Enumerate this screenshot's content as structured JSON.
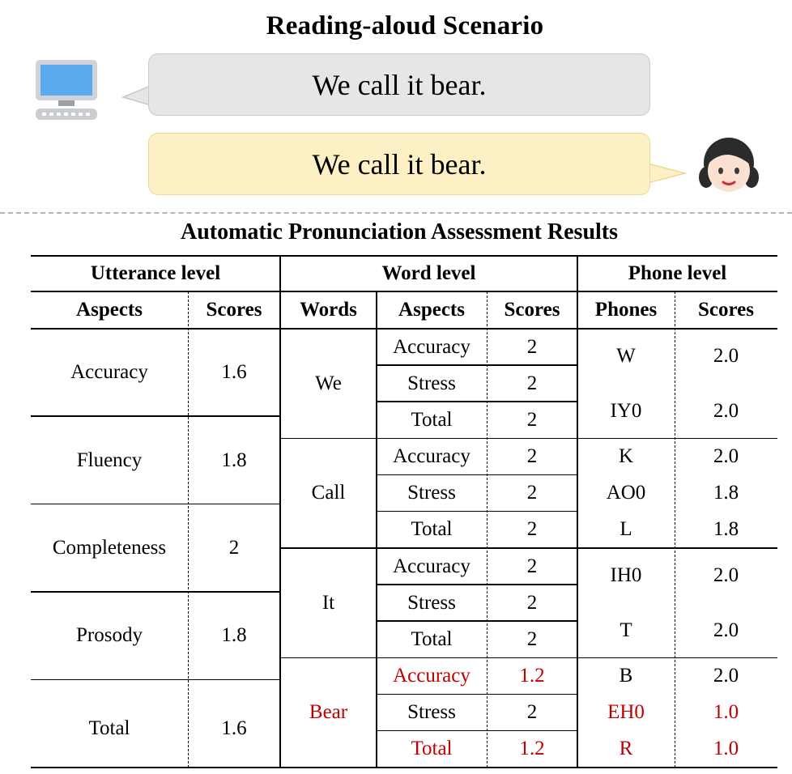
{
  "title": "Reading-aloud Scenario",
  "dialogue": {
    "system_text": "We call it bear.",
    "user_text": "We call it bear."
  },
  "icons": {
    "system": "computer-icon",
    "user": "girl-face-icon"
  },
  "table_title": "Automatic Pronunciation Assessment Results",
  "colors": {
    "error": "#c00000"
  },
  "headers": {
    "utterance_level": "Utterance level",
    "word_level": "Word level",
    "phone_level": "Phone level",
    "aspects": "Aspects",
    "scores": "Scores",
    "words": "Words",
    "phones": "Phones"
  },
  "utterance": [
    {
      "aspect": "Accuracy",
      "score": "1.6"
    },
    {
      "aspect": "Fluency",
      "score": "1.8"
    },
    {
      "aspect": "Completeness",
      "score": "2"
    },
    {
      "aspect": "Prosody",
      "score": "1.8"
    },
    {
      "aspect": "Total",
      "score": "1.6"
    }
  ],
  "words": [
    {
      "word": "We",
      "error": false,
      "rows": [
        {
          "aspect": "Accuracy",
          "score": "2",
          "error": false
        },
        {
          "aspect": "Stress",
          "score": "2",
          "error": false
        },
        {
          "aspect": "Total",
          "score": "2",
          "error": false
        }
      ]
    },
    {
      "word": "Call",
      "error": false,
      "rows": [
        {
          "aspect": "Accuracy",
          "score": "2",
          "error": false
        },
        {
          "aspect": "Stress",
          "score": "2",
          "error": false
        },
        {
          "aspect": "Total",
          "score": "2",
          "error": false
        }
      ]
    },
    {
      "word": "It",
      "error": false,
      "rows": [
        {
          "aspect": "Accuracy",
          "score": "2",
          "error": false
        },
        {
          "aspect": "Stress",
          "score": "2",
          "error": false
        },
        {
          "aspect": "Total",
          "score": "2",
          "error": false
        }
      ]
    },
    {
      "word": "Bear",
      "error": true,
      "rows": [
        {
          "aspect": "Accuracy",
          "score": "1.2",
          "error": true
        },
        {
          "aspect": "Stress",
          "score": "2",
          "error": false
        },
        {
          "aspect": "Total",
          "score": "1.2",
          "error": true
        }
      ]
    }
  ],
  "phones": [
    {
      "phone": "W",
      "score": "2.0",
      "error": false
    },
    {
      "phone": "IY0",
      "score": "2.0",
      "error": false
    },
    {
      "phone": "K",
      "score": "2.0",
      "error": false
    },
    {
      "phone": "AO0",
      "score": "1.8",
      "error": false
    },
    {
      "phone": "L",
      "score": "1.8",
      "error": false
    },
    {
      "phone": "IH0",
      "score": "2.0",
      "error": false
    },
    {
      "phone": "T",
      "score": "2.0",
      "error": false
    },
    {
      "phone": "B",
      "score": "2.0",
      "error": false
    },
    {
      "phone": "EH0",
      "score": "1.0",
      "error": true
    },
    {
      "phone": "R",
      "score": "1.0",
      "error": true
    }
  ]
}
